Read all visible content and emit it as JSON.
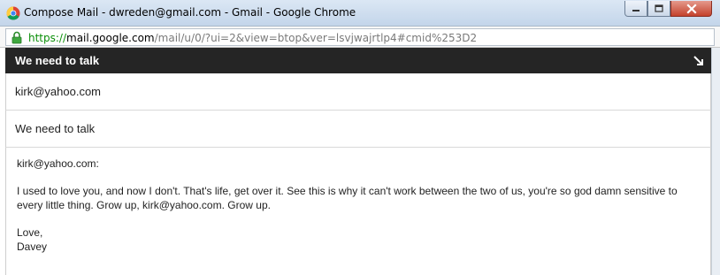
{
  "window": {
    "title": "Compose Mail - dwreden@gmail.com - Gmail - Google Chrome",
    "browser_icon": "chrome-icon",
    "controls": [
      "minimize-icon",
      "maximize-icon",
      "close-icon"
    ]
  },
  "address": {
    "scheme": "https://",
    "host": "mail.google.com",
    "path": "/mail/u/0/?ui=2&view=btop&ver=lsvjwajrtlp4#cmid%253D2",
    "secure_icon": "lock-icon"
  },
  "compose": {
    "header_title": "We need to talk",
    "popout_icon": "popout-arrow-icon",
    "to": "kirk@yahoo.com",
    "subject": "We need to talk",
    "body": {
      "greeting": "kirk@yahoo.com:",
      "paragraph": "I used to love you, and now I don't. That's life, get over it. See this is why it can't work between the two of us, you're so god damn sensitive to every little thing. Grow up, kirk@yahoo.com. Grow up.",
      "closing": "Love,",
      "signature": "Davey"
    }
  },
  "colors": {
    "header_bg": "#252525",
    "scheme_green": "#0a8f08",
    "close_red": "#c4422c"
  }
}
